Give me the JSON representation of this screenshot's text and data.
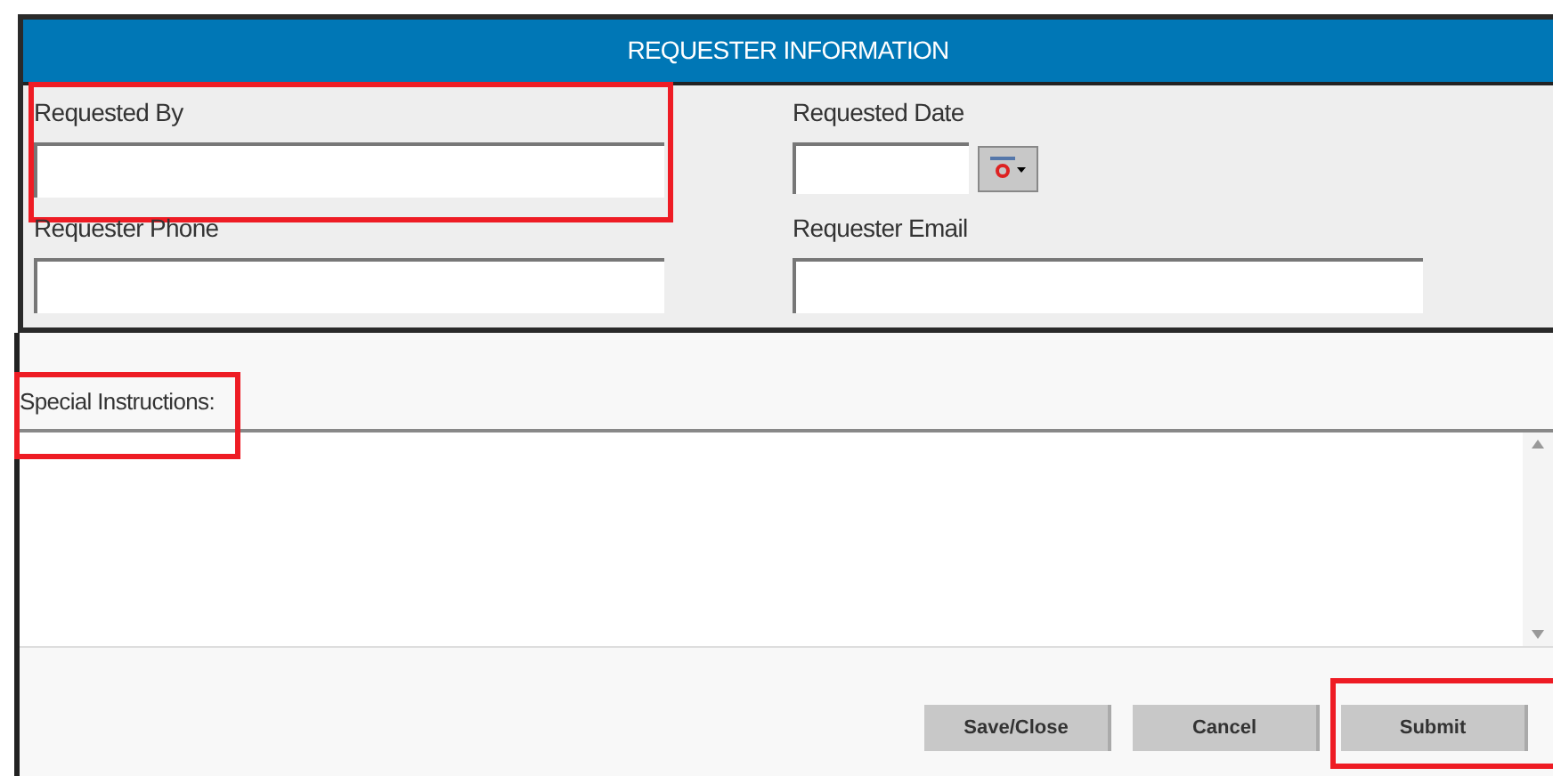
{
  "header": {
    "title": "REQUESTER INFORMATION"
  },
  "fields": [
    {
      "label": "Requested By",
      "kind": "text",
      "highlighted": true
    },
    {
      "label": "Requested Date",
      "kind": "date",
      "highlighted": false
    },
    {
      "label": "Requester Phone",
      "kind": "text",
      "highlighted": false
    },
    {
      "label": "Requester Email",
      "kind": "text",
      "highlighted": false
    }
  ],
  "instructions": {
    "label": "Special Instructions:",
    "highlighted": true
  },
  "buttons": [
    {
      "label": "Save/Close",
      "highlighted": false
    },
    {
      "label": "Cancel",
      "highlighted": false
    },
    {
      "label": "Submit",
      "highlighted": true
    }
  ]
}
